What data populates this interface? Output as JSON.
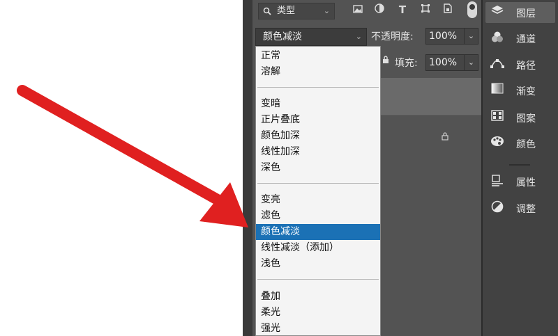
{
  "filter": {
    "kind_label": "类型",
    "icons": [
      "image-filter-icon",
      "adjustment-filter-icon",
      "type-filter-icon",
      "shape-filter-icon",
      "smart-object-filter-icon"
    ]
  },
  "blend": {
    "selected": "颜色减淡",
    "opacity_label": "不透明度:",
    "opacity_value": "100%",
    "fill_label": "填充:",
    "fill_value": "100%"
  },
  "dropdown": {
    "groups": [
      [
        "正常",
        "溶解"
      ],
      [
        "变暗",
        "正片叠底",
        "颜色加深",
        "线性加深",
        "深色"
      ],
      [
        "变亮",
        "滤色",
        "颜色减淡",
        "线性减淡（添加）",
        "浅色"
      ],
      [
        "叠加",
        "柔光",
        "强光"
      ]
    ],
    "selected_item": "颜色减淡"
  },
  "dock": {
    "items": [
      {
        "label": "图层",
        "icon": "layers-icon"
      },
      {
        "label": "通道",
        "icon": "channels-icon"
      },
      {
        "label": "路径",
        "icon": "paths-icon"
      },
      {
        "label": "渐变",
        "icon": "gradients-icon"
      },
      {
        "label": "图案",
        "icon": "patterns-icon"
      },
      {
        "label": "颜色",
        "icon": "color-icon"
      },
      {
        "label": "属性",
        "icon": "properties-icon"
      },
      {
        "label": "调整",
        "icon": "adjustments-icon"
      }
    ]
  },
  "colors": {
    "arrow": "#e02020",
    "selection": "#1b71b5"
  }
}
